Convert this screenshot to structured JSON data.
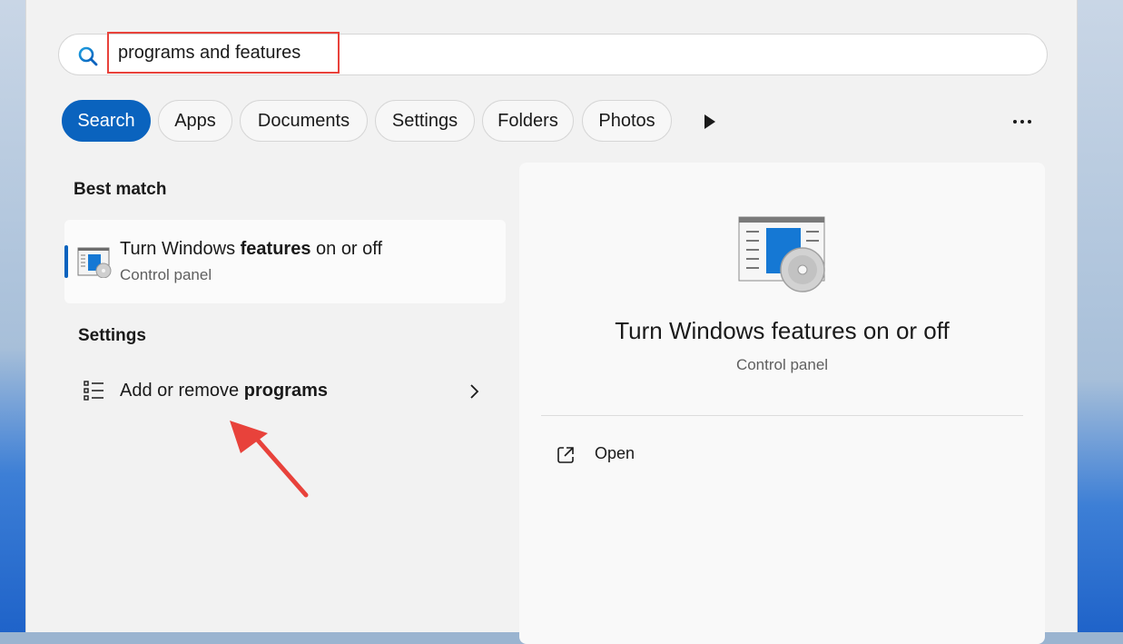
{
  "search": {
    "value": "programs and features"
  },
  "filters": [
    {
      "label": "Search",
      "active": true
    },
    {
      "label": "Apps"
    },
    {
      "label": "Documents"
    },
    {
      "label": "Settings"
    },
    {
      "label": "Folders"
    },
    {
      "label": "Photos"
    }
  ],
  "best_match": {
    "heading": "Best match",
    "title_pre": "Turn Windows ",
    "title_bold": "features",
    "title_post": " on or off",
    "subtitle": "Control panel"
  },
  "settings": {
    "heading": "Settings",
    "item_pre": "Add or remove ",
    "item_bold": "programs"
  },
  "preview": {
    "title": "Turn Windows features on or off",
    "subtitle": "Control panel",
    "open_label": "Open"
  },
  "colors": {
    "accent": "#0a63be",
    "highlight_box": "#e8423b",
    "annotation_arrow": "#e8423b",
    "panel_bg": "#f2f2f2"
  },
  "icons": [
    "search-icon",
    "play-icon",
    "more-icon",
    "control-panel-icon",
    "list-icon",
    "chevron-right-icon",
    "open-external-icon"
  ]
}
